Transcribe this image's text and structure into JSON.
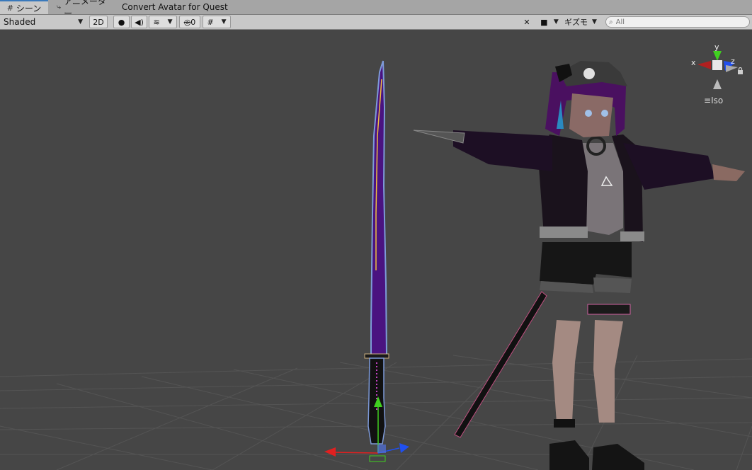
{
  "tabs": [
    {
      "label": "シーン",
      "icon": "scene-grid-icon",
      "active": true
    },
    {
      "label": "アニメーター",
      "icon": "animator-icon",
      "active": false
    },
    {
      "label": "Convert Avatar for Quest",
      "active": false
    }
  ],
  "toolbar": {
    "shading_mode": "Shaded",
    "two_d_label": "2D",
    "hidden_count": "0",
    "gizmos_label": "ギズモ",
    "search_placeholder": "All"
  },
  "gizmo": {
    "axis_y": "y",
    "axis_x": "x",
    "axis_z": "z",
    "projection": "Iso"
  },
  "colors": {
    "tab_accent": "#3a79bb",
    "scene_background": "#464646",
    "axis_x": "#e02020",
    "axis_y": "#40d020",
    "axis_z": "#2050f0"
  }
}
